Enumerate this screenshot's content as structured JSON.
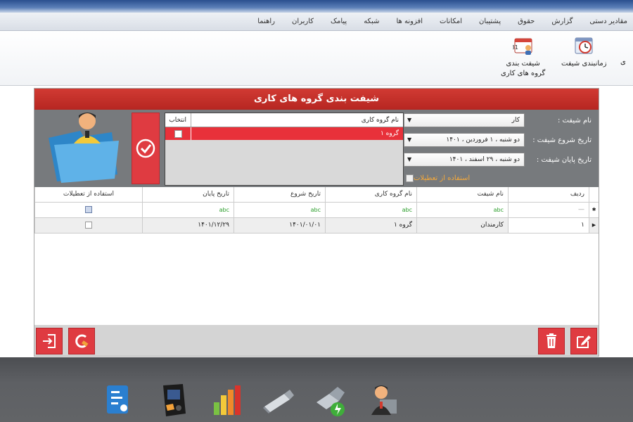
{
  "menu": [
    "مقادیر دستی",
    "گزارش",
    "حقوق",
    "پشتیبان",
    "امکانات",
    "افزونه ها",
    "شبکه",
    "پیامک",
    "کاربران",
    "راهنما"
  ],
  "ribbon": {
    "cut_label": "ی",
    "schedule_label": "زمانبندی شیفت",
    "shift_groups_line1": "شیفت بندی",
    "shift_groups_line2": "گروه های کاری",
    "calendar_number": "31"
  },
  "panel": {
    "title": "شیفت بندی گروه های کاری",
    "shift_name_label": "نام شیفت :",
    "shift_name_value": "کار",
    "start_label": "تاریخ شروع شیفت :",
    "start_value": "دو شنبه ، ۱ فروردین ، ۱۴۰۱",
    "end_label": "تاریخ پایان شیفت :",
    "end_value": "دو شنبه ، ۲۹ اسفند ، ۱۴۰۱",
    "holidays_label": "استفاده از تعطیلات",
    "group_list": {
      "col_name": "نام گروه کاری",
      "col_select": "انتخاب",
      "rows": [
        {
          "name": "گروه ۱"
        }
      ]
    }
  },
  "grid": {
    "headers": [
      "ردیف",
      "نام شیفت",
      "نام گروه کاری",
      "تاریخ شروع",
      "تاریخ پایان",
      "استفاده از تعطیلات"
    ],
    "new_row_marker": "abc",
    "rows": [
      {
        "index": "۱",
        "shift": "کارمندان",
        "group": "گروه ۱",
        "start": "۱۴۰۱/۰۱/۰۱",
        "end": "۱۴۰۱/۱۲/۲۹"
      }
    ]
  },
  "colors": {
    "accent_red": "#df3b41",
    "title_red": "#c4302b",
    "form_gray": "#777a7d",
    "holiday_orange": "#f4a93b"
  }
}
